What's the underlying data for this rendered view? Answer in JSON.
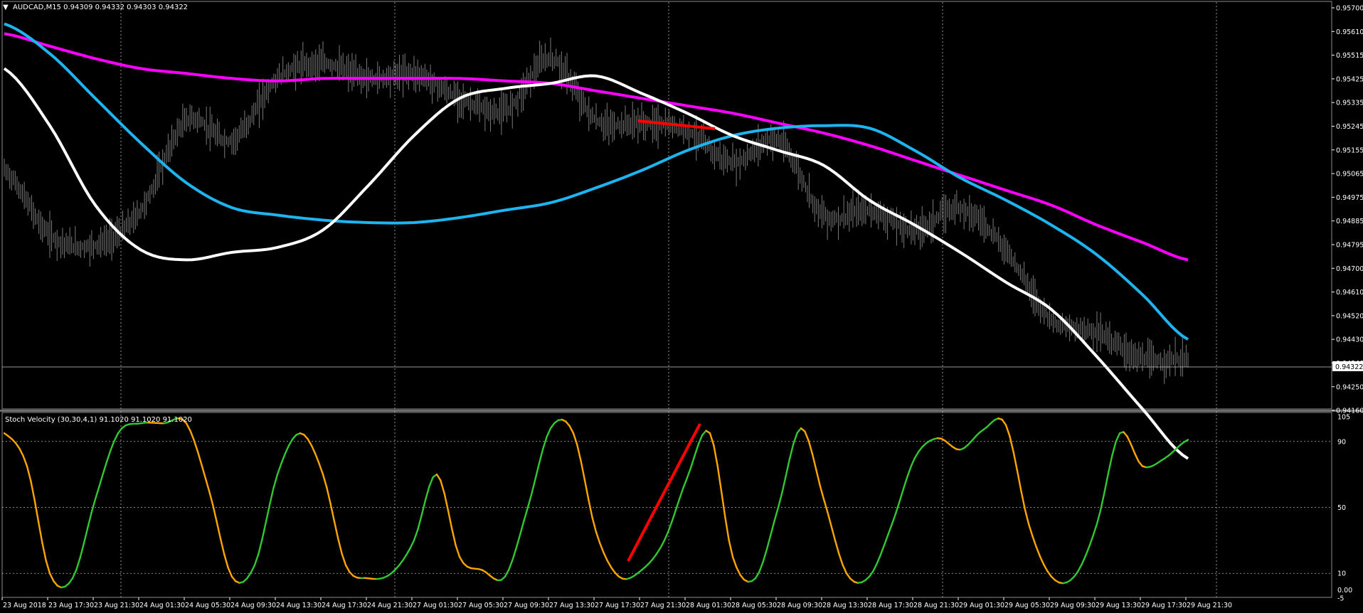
{
  "main_panel": {
    "header": "AUDCAD,M15  0.94309 0.94332 0.94303 0.94322",
    "current_price_label": "0.94322",
    "y_ticks": [
      "0.95700",
      "0.95610",
      "0.95515",
      "0.95425",
      "0.95335",
      "0.95245",
      "0.95155",
      "0.95065",
      "0.94975",
      "0.94885",
      "0.94795",
      "0.94700",
      "0.94610",
      "0.94520",
      "0.94430",
      "0.94340",
      "0.94250",
      "0.94160"
    ]
  },
  "indicator_panel": {
    "header": "Stoch Velocity (30,30,4,1) 91.1020 91.1020 91.1020",
    "y_ticks": [
      "105",
      "90",
      "50",
      "10",
      "0.00",
      "-5"
    ]
  },
  "x_ticks": [
    "23 Aug 2018",
    "23 Aug 17:30",
    "23 Aug 21:30",
    "24 Aug 01:30",
    "24 Aug 05:30",
    "24 Aug 09:30",
    "24 Aug 13:30",
    "24 Aug 17:30",
    "24 Aug 21:30",
    "27 Aug 01:30",
    "27 Aug 05:30",
    "27 Aug 09:30",
    "27 Aug 13:30",
    "27 Aug 17:30",
    "27 Aug 21:30",
    "28 Aug 01:30",
    "28 Aug 05:30",
    "28 Aug 09:30",
    "28 Aug 13:30",
    "28 Aug 17:30",
    "28 Aug 21:30",
    "29 Aug 01:30",
    "29 Aug 05:30",
    "29 Aug 09:30",
    "29 Aug 13:30",
    "29 Aug 17:30",
    "29 Aug 21:30"
  ],
  "chart_data": [
    {
      "type": "line",
      "title": "AUDCAD,M15",
      "ylim": [
        0.9412,
        0.9574
      ],
      "last_price": 0.94322,
      "price_ohlc_last": {
        "open": 0.94309,
        "high": 0.94332,
        "low": 0.94303,
        "close": 0.94322
      },
      "x": [
        0,
        1,
        2,
        3,
        4,
        5,
        6,
        7,
        8,
        9,
        10,
        11,
        12,
        13,
        14,
        15,
        16,
        17,
        18,
        19,
        20,
        21,
        22,
        23,
        24,
        25,
        26
      ],
      "price_close_approx": [
        0.9508,
        0.9482,
        0.9478,
        0.9492,
        0.9528,
        0.952,
        0.9545,
        0.9551,
        0.9545,
        0.9547,
        0.9537,
        0.9532,
        0.9553,
        0.9528,
        0.9527,
        0.9524,
        0.9511,
        0.952,
        0.949,
        0.9492,
        0.9484,
        0.9493,
        0.9476,
        0.9448,
        0.9443,
        0.9432,
        0.9432
      ],
      "series": [
        {
          "color": "#ff00ff",
          "values": [
            0.9563,
            0.9558,
            0.9553,
            0.9549,
            0.9547,
            0.9545,
            0.9544,
            0.9545,
            0.9545,
            0.9545,
            0.9545,
            0.9544,
            0.9543,
            0.954,
            0.9537,
            0.9534,
            0.9531,
            0.9527,
            0.9523,
            0.9518,
            0.9512,
            0.9506,
            0.95,
            0.9494,
            0.9486,
            0.9479,
            0.9472
          ]
        },
        {
          "color": "#1eb4f0",
          "values": [
            0.9567,
            0.9555,
            0.9537,
            0.9519,
            0.9503,
            0.9493,
            0.949,
            0.9488,
            0.9487,
            0.9487,
            0.9489,
            0.9492,
            0.9495,
            0.9501,
            0.9508,
            0.9516,
            0.9522,
            0.9525,
            0.9526,
            0.9525,
            0.9516,
            0.9505,
            0.9496,
            0.9486,
            0.9474,
            0.9458,
            0.944
          ]
        },
        {
          "color": "#ffffff",
          "values": [
            0.9549,
            0.9526,
            0.9494,
            0.9476,
            0.9472,
            0.9475,
            0.9477,
            0.9484,
            0.9502,
            0.9522,
            0.9537,
            0.9541,
            0.9543,
            0.9546,
            0.9539,
            0.9531,
            0.9522,
            0.9516,
            0.951,
            0.9496,
            0.9486,
            0.9475,
            0.9463,
            0.9452,
            0.9433,
            0.9412,
            0.9392
          ]
        }
      ],
      "drawn_line": {
        "color": "#ff0000"
      }
    },
    {
      "type": "line",
      "title": "Stoch Velocity (30,30,4,1)",
      "ylim": [
        -5,
        105
      ],
      "levels": [
        90,
        50,
        10
      ],
      "last_value": 91.102,
      "up_color": "#32c832",
      "down_color": "#ffa500",
      "x": [
        0,
        0.5,
        1,
        1.5,
        2,
        2.5,
        3,
        3.5,
        4,
        4.5,
        5,
        5.5,
        6,
        6.5,
        7,
        7.5,
        8,
        8.5,
        9,
        9.5,
        10,
        10.5,
        11,
        11.5,
        12,
        12.5,
        13,
        13.5,
        14,
        14.5,
        15,
        15.5,
        16,
        16.5,
        17,
        17.5,
        18,
        18.5,
        19,
        19.5,
        20,
        20.5,
        21,
        21.5,
        22,
        22.5,
        23,
        23.5,
        24,
        24.5,
        25,
        25.5,
        26
      ],
      "values": [
        95,
        75,
        10,
        7,
        55,
        95,
        101,
        101,
        101,
        60,
        8,
        15,
        70,
        95,
        70,
        15,
        7,
        10,
        30,
        70,
        20,
        12,
        8,
        50,
        98,
        95,
        35,
        8,
        12,
        30,
        68,
        95,
        20,
        7,
        50,
        98,
        55,
        10,
        8,
        40,
        80,
        92,
        85,
        97,
        100,
        40,
        8,
        8,
        40,
        95,
        75,
        80,
        91
      ]
    }
  ]
}
